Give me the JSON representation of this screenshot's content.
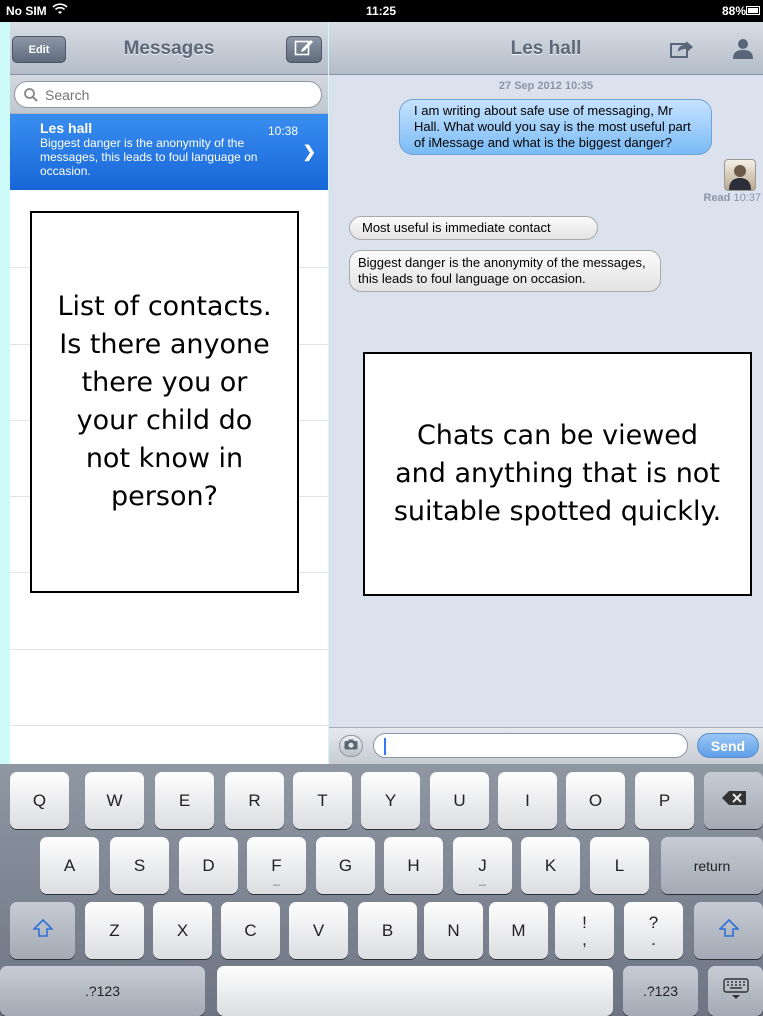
{
  "status_bar": {
    "carrier": "No SIM",
    "time": "11:25",
    "battery": "88%"
  },
  "sidebar": {
    "edit_label": "Edit",
    "title": "Messages",
    "search_placeholder": "Search",
    "conversations": [
      {
        "name": "Les hall",
        "time": "10:38",
        "preview": "Biggest danger is the anonymity of the messages, this leads to foul language on occasion."
      }
    ]
  },
  "chat": {
    "title": "Les hall",
    "date": "27 Sep 2012 10:35",
    "messages": [
      {
        "dir": "out",
        "text": "I am writing about safe use of messaging, Mr Hall. What would you say is the most useful part of iMessage and what is the biggest danger?"
      },
      {
        "dir": "in",
        "text": "Most useful is immediate contact"
      },
      {
        "dir": "in",
        "text": "Biggest danger is the anonymity of the messages, this leads to foul language on occasion."
      }
    ],
    "read_label": "Read",
    "read_time": "10:37",
    "input_value": "",
    "send_label": "Send"
  },
  "keyboard": {
    "row1": [
      "Q",
      "W",
      "E",
      "R",
      "T",
      "Y",
      "U",
      "I",
      "O",
      "P"
    ],
    "row2": [
      "A",
      "S",
      "D",
      "F",
      "G",
      "H",
      "J",
      "K",
      "L"
    ],
    "row3": [
      "Z",
      "X",
      "C",
      "V",
      "B",
      "N",
      "M"
    ],
    "return_label": "return",
    "excl_top": "!",
    "excl_bottom": ",",
    "quest_top": "?",
    "quest_bottom": ".",
    "numbers_label": ".?123",
    "numbers_label_right": ".?123"
  },
  "annotations": {
    "left": "List of contacts. Is there anyone there you or your child do not know in person?",
    "right": "Chats can be viewed and anything that is not suitable spotted quickly."
  },
  "colors": {
    "accent_blue": "#1f73df",
    "outgoing_bubble": "#9ccdf9",
    "incoming_bubble": "#f0f0f0",
    "chat_background": "#dbe2ed",
    "page_border": "#ccfbf9"
  }
}
